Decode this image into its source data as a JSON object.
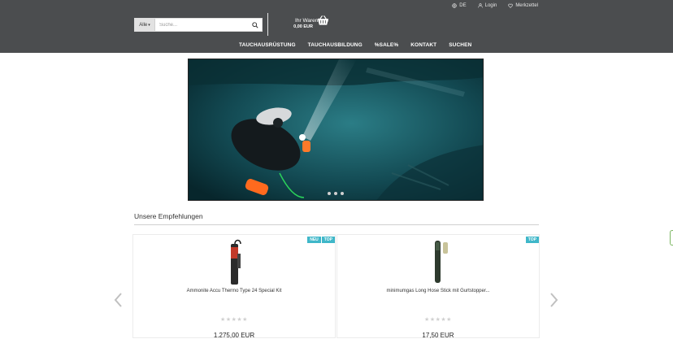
{
  "topbar": {
    "language": "DE",
    "login": "Login",
    "wishlist": "Merkzettel"
  },
  "search": {
    "category": "Alle",
    "placeholder": "Suche..."
  },
  "cart": {
    "label": "Ihr Warenkorb",
    "total": "0,00 EUR"
  },
  "nav": {
    "items": [
      "TAUCHAUSRÜSTUNG",
      "TAUCHAUSBILDUNG",
      "%SALE%",
      "KONTAKT",
      "SUCHEN"
    ]
  },
  "section": {
    "title": "Unsere Empfehlungen"
  },
  "products": [
    {
      "name": "Ammonite Accu Thermo Type 24 Special Kit",
      "price": "1.275,00 EUR",
      "badges": [
        "NEU",
        "TOP"
      ]
    },
    {
      "name": "minimumgas Long Hose Stick mit Gurtstopper...",
      "price": "17,50 EUR",
      "badges": [
        "TOP"
      ]
    }
  ],
  "colors": {
    "header_bg": "#4b4d4f",
    "badge_bg": "#3fb7c9"
  }
}
